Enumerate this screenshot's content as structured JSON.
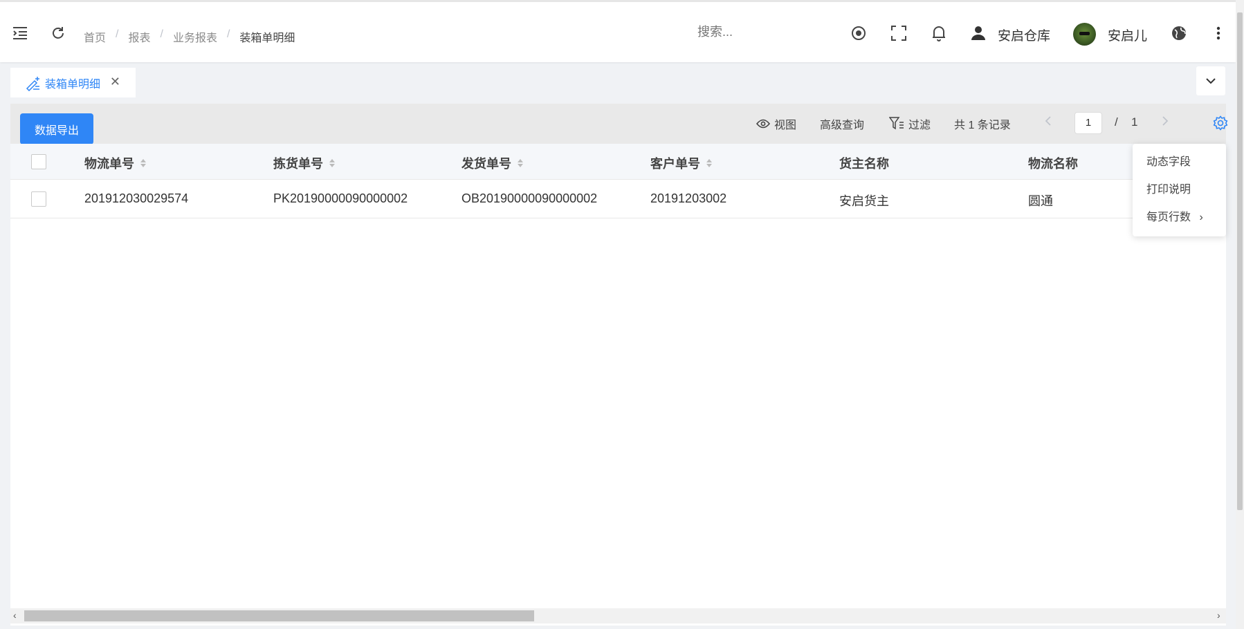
{
  "header": {
    "breadcrumb": [
      "首页",
      "报表",
      "业务报表",
      "装箱单明细"
    ],
    "breadcrumb_sep": "/",
    "search_placeholder": "搜索...",
    "warehouse": "安启仓库",
    "username": "安启儿",
    "icons": [
      "menu-fold-icon",
      "refresh-icon",
      "target-icon",
      "fullscreen-icon",
      "bell-icon",
      "user-icon",
      "globe-icon",
      "more-vertical-icon"
    ]
  },
  "tabs": [
    {
      "label": "装箱单明细",
      "icon": "edit-pen-icon",
      "active": true
    }
  ],
  "toolbar": {
    "export_label": "数据导出",
    "view_label": "视图",
    "advanced_query_label": "高级查询",
    "filter_label": "过滤",
    "records_text": "共 1 条记录",
    "current_page": "1",
    "page_sep": "/",
    "total_pages": "1"
  },
  "table": {
    "columns": [
      "物流单号",
      "拣货单号",
      "发货单号",
      "客户单号",
      "货主名称",
      "物流名称"
    ],
    "sortable": [
      true,
      true,
      true,
      true,
      false,
      false
    ],
    "rows": [
      [
        "201912030029574",
        "PK20190000090000002",
        "OB20190000090000002",
        "20191203002",
        "安启货主",
        "圆通"
      ]
    ]
  },
  "settings_menu": {
    "items": [
      "动态字段",
      "打印说明",
      "每页行数"
    ],
    "submenu_indicator": "›"
  },
  "colors": {
    "primary": "#2f86f6",
    "toolbar_bg": "#e9e9e9",
    "header_row_bg": "#f5f7fa"
  }
}
